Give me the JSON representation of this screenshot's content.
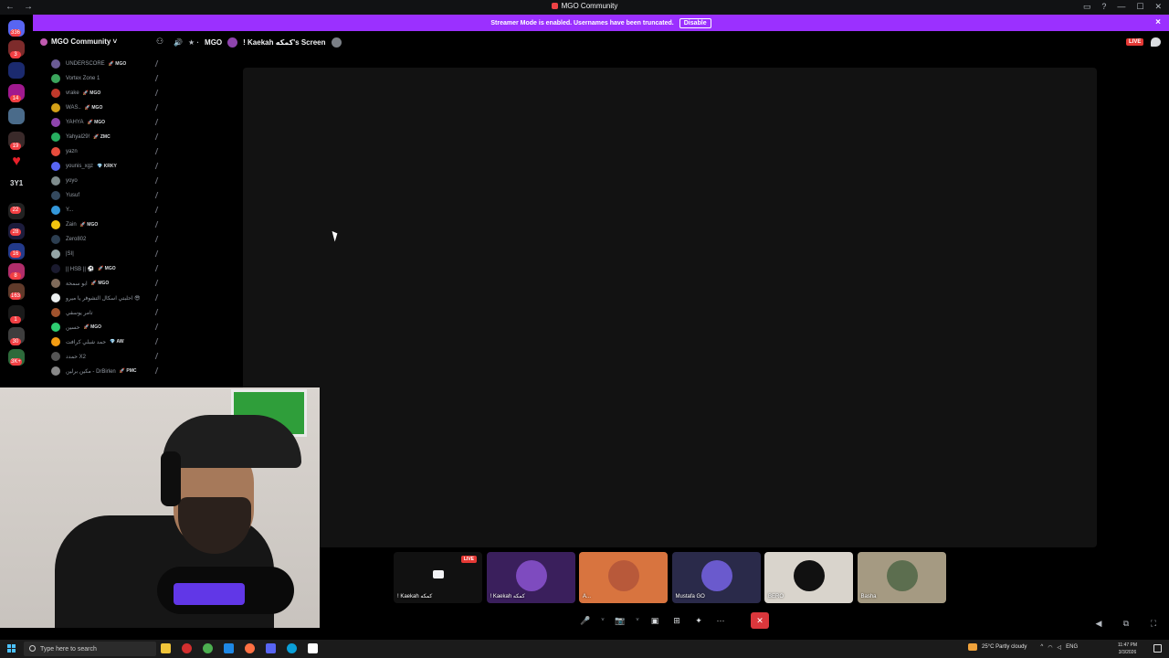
{
  "window": {
    "title": "MGO Community",
    "nav_back": "←",
    "nav_forward": "→"
  },
  "banner": {
    "text": "Streamer Mode is enabled. Usernames have been truncated.",
    "disable_label": "Disable",
    "close": "×"
  },
  "rail": {
    "count_label": "3Y1",
    "pills": [
      "336",
      "3",
      "14",
      "19",
      "22",
      "28",
      "16",
      "8",
      "163",
      "1",
      "30",
      "3K+"
    ]
  },
  "sidebar": {
    "server_name": "MGO Community ˅",
    "members": [
      {
        "name": "UNDERSCORE",
        "tag": "🚀 MGO",
        "color": "#6b5b95"
      },
      {
        "name": "Vortex Zone 1",
        "tag": "",
        "color": "#3ba55c"
      },
      {
        "name": "vrake",
        "tag": "🚀 MGO",
        "color": "#c0392b"
      },
      {
        "name": "WAS..",
        "tag": "🚀 MGO",
        "color": "#d4a017"
      },
      {
        "name": "YAHYA",
        "tag": "🚀 MGO",
        "color": "#8e44ad"
      },
      {
        "name": "Yahyal29!",
        "tag": "🚀 ZMC",
        "color": "#27ae60"
      },
      {
        "name": "yazn",
        "tag": "",
        "color": "#e74c3c"
      },
      {
        "name": "younis_xgz",
        "tag": "💎 KRKY",
        "color": "#5865f2"
      },
      {
        "name": "yoyo",
        "tag": "",
        "color": "#7f8c8d"
      },
      {
        "name": "Yusuf",
        "tag": "",
        "color": "#34495e"
      },
      {
        "name": "Y...",
        "tag": "",
        "color": "#3498db"
      },
      {
        "name": "Zain",
        "tag": "🚀 MGO",
        "color": "#f1c40f"
      },
      {
        "name": "Zero802",
        "tag": "",
        "color": "#2c3e50"
      },
      {
        "name": "|SI|",
        "tag": "",
        "color": "#95a5a6"
      },
      {
        "name": "|| HSB || ⚽",
        "tag": "🚀 MGO",
        "color": "#1a1a2e"
      },
      {
        "name": "ابو سمحة",
        "tag": "🚀 MGO",
        "color": "#7f6a5a"
      },
      {
        "name": "احلبتي اسكال التشوفر يا ميرو 😎",
        "tag": "",
        "color": "#ecf0f1"
      },
      {
        "name": "تامر يوسفي",
        "tag": "",
        "color": "#a0522d"
      },
      {
        "name": "حسين",
        "tag": "🚀 MGO",
        "color": "#2ecc71"
      },
      {
        "name": "حمد شبلي كرافت",
        "tag": "💎 AW",
        "color": "#f39c12"
      },
      {
        "name": "حمدد X2",
        "tag": "",
        "color": "#555555"
      },
      {
        "name": "مكين برلين - DrBirlen",
        "tag": "🚀 PMC",
        "color": "#888888"
      }
    ]
  },
  "stage": {
    "channel": "MGO",
    "screen_title": "! Kaekah كمكه's Screen",
    "live_badge": "LIVE"
  },
  "participants": [
    {
      "label": "! Kaekah كمكه",
      "kind": "screen",
      "live": "LIVE",
      "bg": "#111111"
    },
    {
      "label": "! Kaekah كمكه",
      "kind": "avatar",
      "bg": "#3a1f5c",
      "photo": "#7e4bbf"
    },
    {
      "label": "A...",
      "kind": "avatar",
      "bg": "#d8743f",
      "photo": "#b8593a"
    },
    {
      "label": "Mustafa GO",
      "kind": "avatar",
      "bg": "#2a2a4a",
      "photo": "#6a5acd"
    },
    {
      "label": "BERO",
      "kind": "avatar",
      "bg": "#d9d4cc",
      "photo": "#111111"
    },
    {
      "label": "Basha",
      "kind": "avatar",
      "bg": "#a59a82",
      "photo": "#5c6e4f"
    }
  ],
  "controls": {
    "mic": "🎤",
    "mic_menu": "˅",
    "camera": "📷",
    "camera_menu": "˅",
    "screenshare": "▣",
    "activities": "⊞",
    "soundboard": "✦",
    "more": "···",
    "leave": "✕"
  },
  "right_controls": {
    "volume": "◀",
    "popout": "⧉",
    "fullscreen": "⛶"
  },
  "taskbar": {
    "search_placeholder": "Type here to search",
    "weather": "25°C  Partly cloudy",
    "lang": "ENG",
    "time": "11:47 PM",
    "date": "3/3/2026"
  }
}
